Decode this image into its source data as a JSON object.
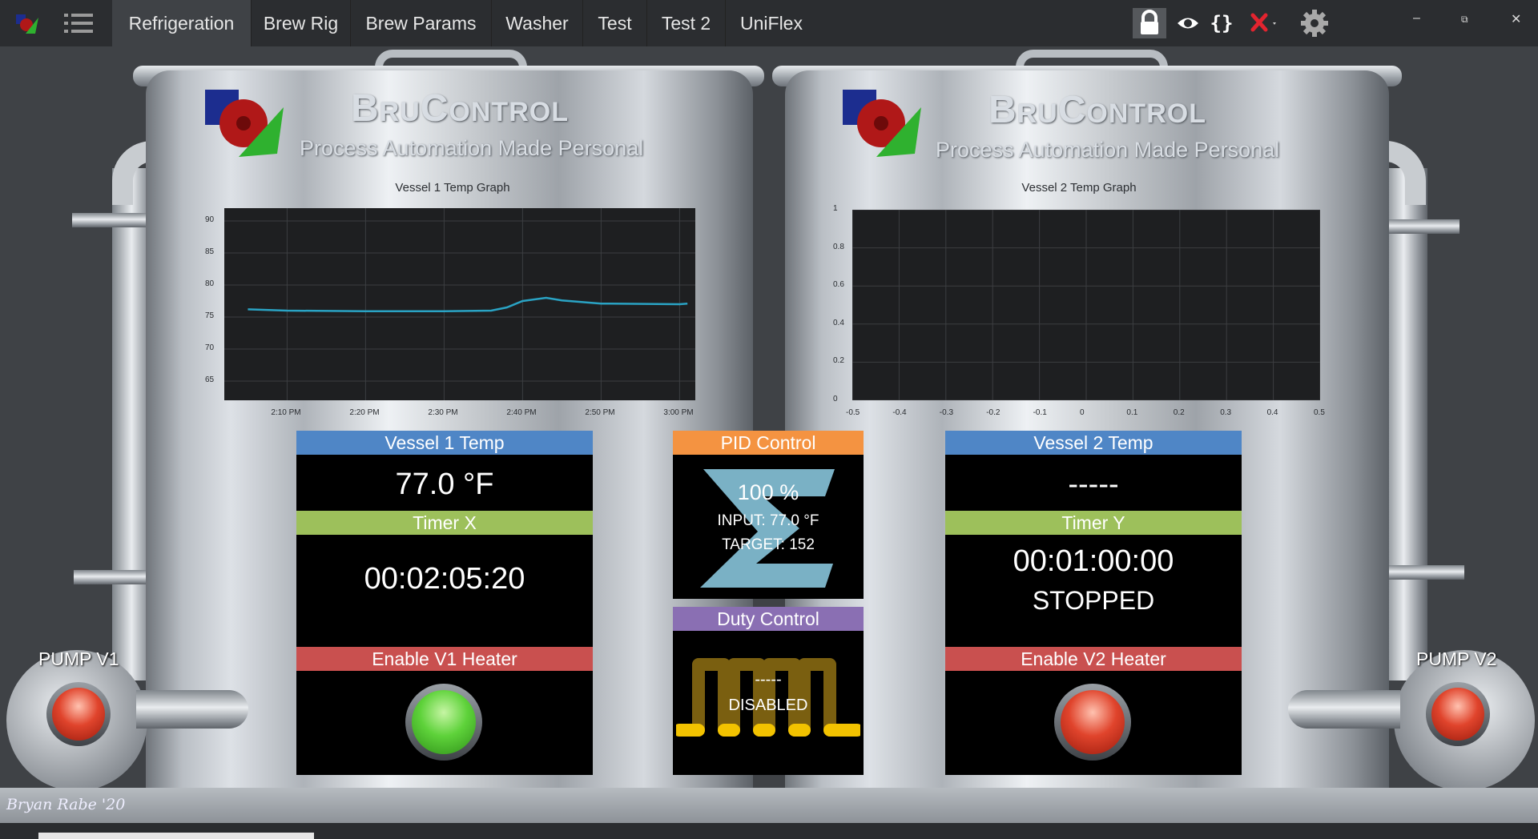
{
  "tabs": [
    {
      "label": "Refrigeration",
      "active": true
    },
    {
      "label": "Brew Rig",
      "active": false
    },
    {
      "label": "Brew Params",
      "active": false
    },
    {
      "label": "Washer",
      "active": false
    },
    {
      "label": "Test",
      "active": false
    },
    {
      "label": "Test 2",
      "active": false
    },
    {
      "label": "UniFlex",
      "active": false
    }
  ],
  "toolbar_icons": [
    "lock-icon",
    "eye-icon",
    "braces-icon",
    "close-x-icon",
    "gear-icon"
  ],
  "window_controls": {
    "minimize": "–",
    "restore": "⧉",
    "close": "✕"
  },
  "brand": {
    "title": "BruControl",
    "tagline": "Process Automation Made Personal"
  },
  "vessel1": {
    "graph_title": "Vessel 1 Temp Graph",
    "y_ticks": [
      "90",
      "85",
      "80",
      "75",
      "70",
      "65"
    ],
    "x_ticks": [
      "2:10 PM",
      "2:20 PM",
      "2:30 PM",
      "2:40 PM",
      "2:50 PM",
      "3:00 PM"
    ]
  },
  "vessel2": {
    "graph_title": "Vessel 2 Temp Graph",
    "y_ticks": [
      "1",
      "0.8",
      "0.6",
      "0.4",
      "0.2",
      "0"
    ],
    "x_ticks": [
      "-0.5",
      "-0.4",
      "-0.3",
      "-0.2",
      "-0.1",
      "0",
      "0.1",
      "0.2",
      "0.3",
      "0.4",
      "0.5"
    ]
  },
  "chart_data": [
    {
      "type": "line",
      "title": "Vessel 1 Temp Graph",
      "ylim": [
        62,
        92
      ],
      "x": [
        "2:05 PM",
        "2:10 PM",
        "2:20 PM",
        "2:30 PM",
        "2:36 PM",
        "2:38 PM",
        "2:40 PM",
        "2:43 PM",
        "2:45 PM",
        "2:50 PM",
        "3:00 PM",
        "3:01 PM"
      ],
      "series": [
        {
          "values": [
            76.2,
            76.0,
            75.9,
            75.9,
            76.0,
            76.5,
            77.5,
            78.0,
            77.6,
            77.1,
            77.0,
            77.1
          ],
          "color": "#2aa3c4"
        }
      ]
    },
    {
      "type": "line",
      "title": "Vessel 2 Temp Graph",
      "xlim": [
        -0.5,
        0.5
      ],
      "ylim": [
        0,
        1
      ],
      "series": []
    }
  ],
  "panels": {
    "vessel1_temp": {
      "title": "Vessel 1 Temp",
      "value": "77.0 °F"
    },
    "timer_x": {
      "title": "Timer X",
      "value": "00:02:05:20"
    },
    "v1_heater": {
      "title": "Enable V1 Heater",
      "state": "on"
    },
    "pid": {
      "title": "PID Control",
      "output": "100 %",
      "input": "INPUT: 77.0 °F",
      "target": "TARGET: 152"
    },
    "duty": {
      "title": "Duty Control",
      "value": "-----",
      "status": "DISABLED"
    },
    "vessel2_temp": {
      "title": "Vessel 2 Temp",
      "value": "-----"
    },
    "timer_y": {
      "title": "Timer Y",
      "value": "00:01:00:00",
      "status": "STOPPED"
    },
    "v2_heater": {
      "title": "Enable V2 Heater",
      "state": "off"
    }
  },
  "pumps": {
    "v1": "PUMP V1",
    "v2": "PUMP V2"
  },
  "signature": "Bryan Rabe '20",
  "colors": {
    "on_lamp": "#5ed23a",
    "off_lamp": "#e0442c",
    "line": "#2aa3c4"
  }
}
